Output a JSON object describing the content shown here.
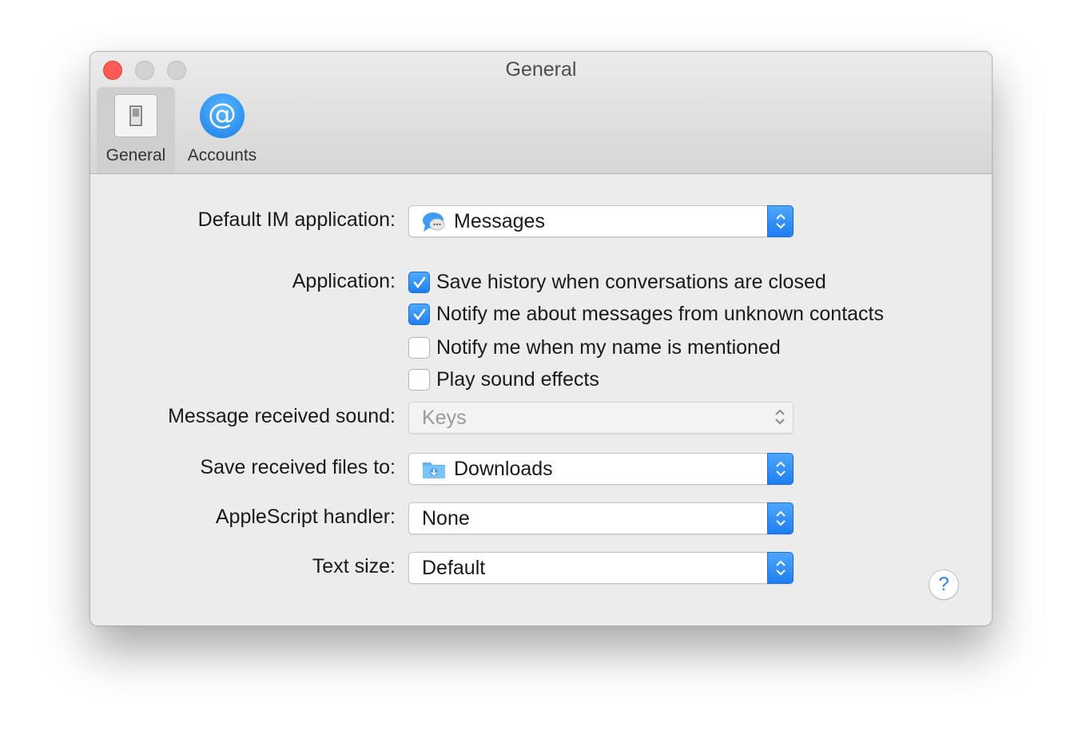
{
  "window": {
    "title": "General"
  },
  "toolbar": {
    "tabs": [
      {
        "label": "General",
        "icon": "switch-icon",
        "selected": true
      },
      {
        "label": "Accounts",
        "icon": "at-icon",
        "selected": false
      }
    ]
  },
  "settings": {
    "default_im": {
      "label": "Default IM application:",
      "value": "Messages",
      "icon": "messages-icon"
    },
    "application": {
      "label": "Application:",
      "options": [
        {
          "label": "Save history when conversations are closed",
          "checked": true
        },
        {
          "label": "Notify me about messages from unknown contacts",
          "checked": true
        },
        {
          "label": "Notify me when my name is mentioned",
          "checked": false
        },
        {
          "label": "Play sound effects",
          "checked": false
        }
      ]
    },
    "received_sound": {
      "label": "Message received sound:",
      "value": "Keys",
      "enabled": false
    },
    "save_files": {
      "label": "Save received files to:",
      "value": "Downloads",
      "icon": "downloads-folder-icon"
    },
    "applescript": {
      "label": "AppleScript handler:",
      "value": "None"
    },
    "text_size": {
      "label": "Text size:",
      "value": "Default"
    }
  },
  "help": {
    "label": "?"
  },
  "colors": {
    "accent": "#1f7ff0",
    "close": "#fc5b57",
    "background": "#ececec"
  }
}
